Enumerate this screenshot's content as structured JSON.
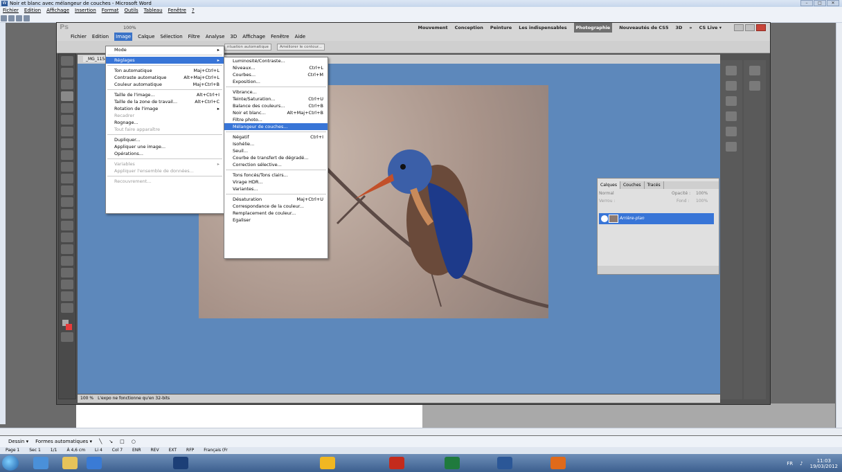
{
  "word": {
    "title": "Noir et blanc avec mélangeur de couches - Microsoft Word",
    "menu": [
      "Fichier",
      "Edition",
      "Affichage",
      "Insertion",
      "Format",
      "Outils",
      "Tableau",
      "Fenêtre",
      "?"
    ],
    "draw_label": "Dessin ▾",
    "autoshapes_label": "Formes automatiques ▾",
    "status": [
      "Page 1",
      "Sec 1",
      "1/1",
      "À 4,6 cm",
      "Li 4",
      "Col 7",
      "ENR",
      "REV",
      "EXT",
      "RFP",
      "Français (Fr"
    ],
    "window_controls": [
      "–",
      "□",
      "✕"
    ]
  },
  "taskbar": {
    "lang": "FR",
    "time": "11:03",
    "date": "19/03/2012"
  },
  "ps": {
    "logo": "Ps",
    "zoom": "100%",
    "workspaces": [
      "Mouvement",
      "Conception",
      "Peinture",
      "Les indispensables",
      "Photographie",
      "Nouveautés de CS5",
      "3D",
      "»"
    ],
    "active_workspace": "Photographie",
    "cslive": "CS Live ▾",
    "menu": [
      "Fichier",
      "Edition",
      "Image",
      "Calque",
      "Sélection",
      "Filtre",
      "Analyse",
      "3D",
      "Affichage",
      "Fenêtre",
      "Aide"
    ],
    "active_menu": "Image",
    "options": {
      "auto_btn": "ntuation automatique",
      "refine_btn": "Améliorer le contour..."
    },
    "doc_tab": "_MG_1154-2",
    "status": {
      "zoom": "100 %",
      "message": "L'expo ne fonctionne qu'en 32-bits"
    },
    "layers": {
      "tabs": [
        "Calques",
        "Couches",
        "Tracés"
      ],
      "mode": "Normal",
      "opacity_label": "Opacité :",
      "opacity": "100%",
      "lock_label": "Verrou :",
      "fill_label": "Fond :",
      "fill": "100%",
      "layer_name": "Arrière-plan"
    }
  },
  "menu_image": {
    "items": [
      {
        "label": "Mode",
        "shortcut": "▸",
        "state": "normal"
      },
      {
        "sep": true
      },
      {
        "label": "Réglages",
        "shortcut": "▸",
        "state": "selected"
      },
      {
        "sep": true
      },
      {
        "label": "Ton automatique",
        "shortcut": "Maj+Ctrl+L",
        "state": "normal"
      },
      {
        "label": "Contraste automatique",
        "shortcut": "Alt+Maj+Ctrl+L",
        "state": "normal"
      },
      {
        "label": "Couleur automatique",
        "shortcut": "Maj+Ctrl+B",
        "state": "normal"
      },
      {
        "sep": true
      },
      {
        "label": "Taille de l'image...",
        "shortcut": "Alt+Ctrl+I",
        "state": "normal"
      },
      {
        "label": "Taille de la zone de travail...",
        "shortcut": "Alt+Ctrl+C",
        "state": "normal"
      },
      {
        "label": "Rotation de l'image",
        "shortcut": "▸",
        "state": "normal"
      },
      {
        "label": "Recadrer",
        "shortcut": "",
        "state": "disabled"
      },
      {
        "label": "Rognage...",
        "shortcut": "",
        "state": "normal"
      },
      {
        "label": "Tout faire apparaître",
        "shortcut": "",
        "state": "disabled"
      },
      {
        "sep": true
      },
      {
        "label": "Dupliquer...",
        "shortcut": "",
        "state": "normal"
      },
      {
        "label": "Appliquer une image...",
        "shortcut": "",
        "state": "normal"
      },
      {
        "label": "Opérations...",
        "shortcut": "",
        "state": "normal"
      },
      {
        "sep": true
      },
      {
        "label": "Variables",
        "shortcut": "▸",
        "state": "disabled"
      },
      {
        "label": "Appliquer l'ensemble de données...",
        "shortcut": "",
        "state": "disabled"
      },
      {
        "sep": true
      },
      {
        "label": "Recouvrement...",
        "shortcut": "",
        "state": "disabled"
      }
    ]
  },
  "menu_reglages": {
    "items": [
      {
        "label": "Luminosité/Contraste...",
        "shortcut": "",
        "state": "normal"
      },
      {
        "label": "Niveaux...",
        "shortcut": "Ctrl+L",
        "state": "normal"
      },
      {
        "label": "Courbes...",
        "shortcut": "Ctrl+M",
        "state": "normal"
      },
      {
        "label": "Exposition...",
        "shortcut": "",
        "state": "normal"
      },
      {
        "sep": true
      },
      {
        "label": "Vibrance...",
        "shortcut": "",
        "state": "normal"
      },
      {
        "label": "Teinte/Saturation...",
        "shortcut": "Ctrl+U",
        "state": "normal"
      },
      {
        "label": "Balance des couleurs...",
        "shortcut": "Ctrl+B",
        "state": "normal"
      },
      {
        "label": "Noir et blanc...",
        "shortcut": "Alt+Maj+Ctrl+B",
        "state": "normal"
      },
      {
        "label": "Filtre photo...",
        "shortcut": "",
        "state": "normal"
      },
      {
        "label": "Mélangeur de couches...",
        "shortcut": "",
        "state": "selected"
      },
      {
        "sep": true
      },
      {
        "label": "Négatif",
        "shortcut": "Ctrl+I",
        "state": "normal"
      },
      {
        "label": "Isohélie...",
        "shortcut": "",
        "state": "normal"
      },
      {
        "label": "Seuil...",
        "shortcut": "",
        "state": "normal"
      },
      {
        "label": "Courbe de transfert de dégradé...",
        "shortcut": "",
        "state": "normal"
      },
      {
        "label": "Correction sélective...",
        "shortcut": "",
        "state": "normal"
      },
      {
        "sep": true
      },
      {
        "label": "Tons foncés/Tons clairs...",
        "shortcut": "",
        "state": "normal"
      },
      {
        "label": "Virage HDR...",
        "shortcut": "",
        "state": "normal"
      },
      {
        "label": "Variantes...",
        "shortcut": "",
        "state": "normal"
      },
      {
        "sep": true
      },
      {
        "label": "Désaturation",
        "shortcut": "Maj+Ctrl+U",
        "state": "normal"
      },
      {
        "label": "Correspondance de la couleur...",
        "shortcut": "",
        "state": "normal"
      },
      {
        "label": "Remplacement de couleur...",
        "shortcut": "",
        "state": "normal"
      },
      {
        "label": "Egaliser",
        "shortcut": "",
        "state": "normal"
      }
    ]
  }
}
